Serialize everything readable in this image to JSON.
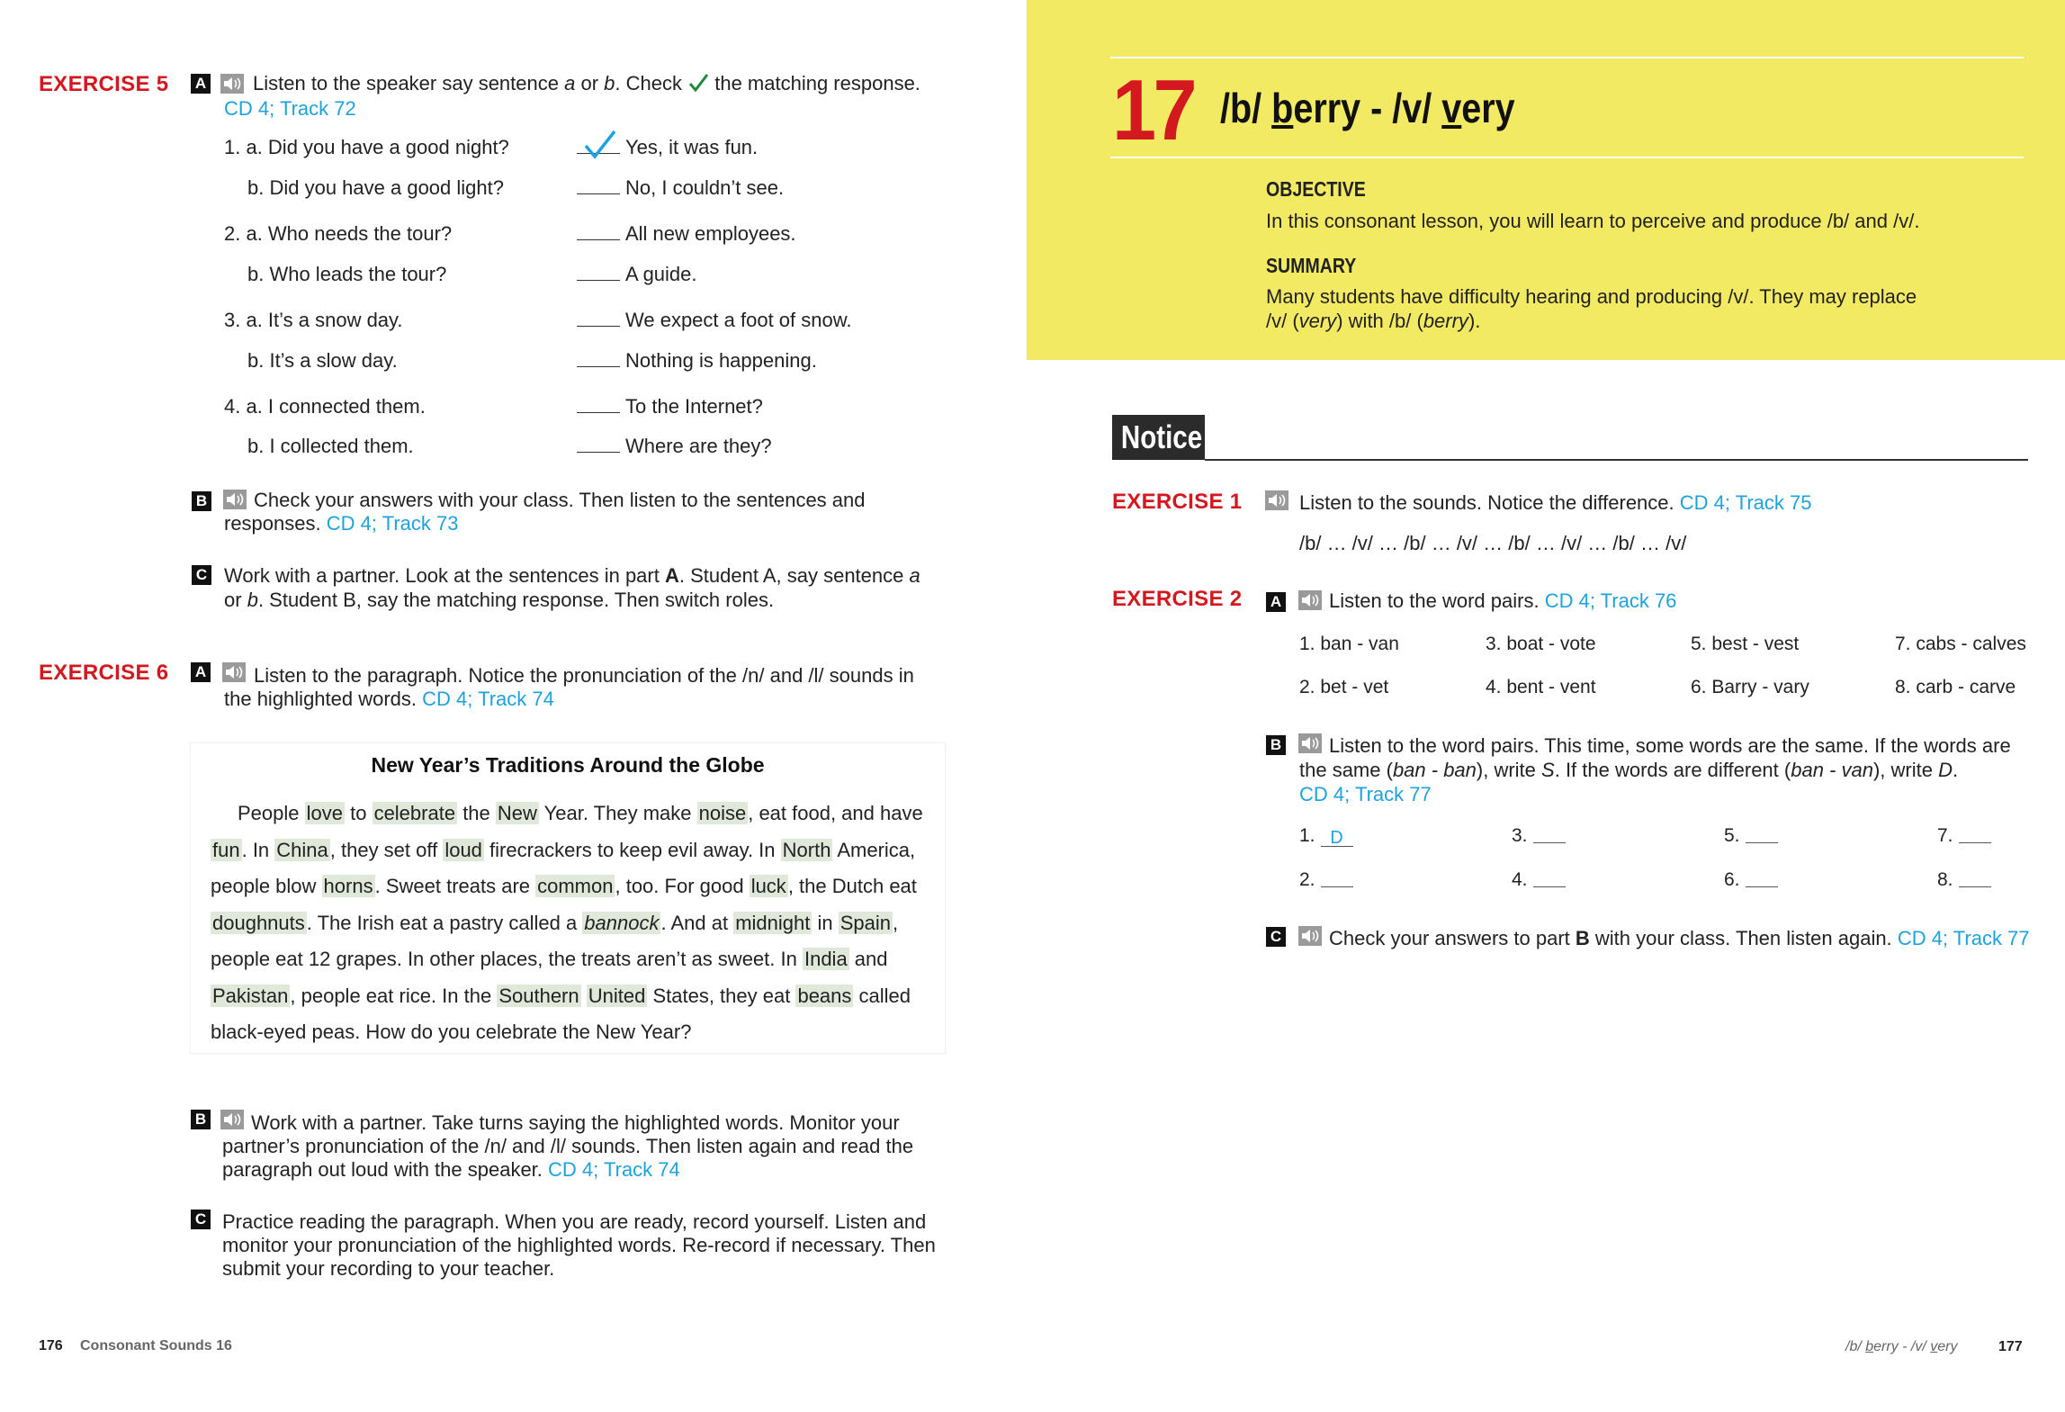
{
  "left": {
    "ex5": {
      "label": "EXERCISE 5",
      "a_letter": "A",
      "a_text1": "Listen to the speaker say sentence ",
      "a_text_a": "a",
      "a_text_or": " or ",
      "a_text_b": "b",
      "a_text2": ". Check ",
      "a_text3": " the matching response.",
      "a_track": "CD 4; Track 72",
      "items": [
        {
          "q": "1. a. Did you have a good night?",
          "r": "Yes, it was fun.",
          "checked": true
        },
        {
          "q": "b. Did you have a good light?",
          "r": "No, I couldn’t see.",
          "checked": false
        },
        {
          "q": "2. a. Who needs the tour?",
          "r": "All new employees.",
          "checked": false
        },
        {
          "q": "b. Who leads the tour?",
          "r": "A guide.",
          "checked": false
        },
        {
          "q": "3. a. It’s a snow day.",
          "r": "We expect a foot of snow.",
          "checked": false
        },
        {
          "q": "b. It’s a slow day.",
          "r": "Nothing is happening.",
          "checked": false
        },
        {
          "q": "4. a. I connected them.",
          "r": "To the Internet?",
          "checked": false
        },
        {
          "q": "b. I collected them.",
          "r": "Where are they?",
          "checked": false
        }
      ],
      "b_letter": "B",
      "b_text1": "Check your answers with your class. Then listen to the sentences and",
      "b_text2": "responses.",
      "b_track": "CD 4; Track 73",
      "c_letter": "C",
      "c_text1a": "Work with a partner. Look at the sentences in part ",
      "c_text1b": "A",
      "c_text1c": ". Student A, say sentence ",
      "c_text1d": "a",
      "c_text2a": "or ",
      "c_text2b": "b",
      "c_text2c": ". Student B, say the matching response. Then switch roles."
    },
    "ex6": {
      "label": "EXERCISE 6",
      "a_letter": "A",
      "a_text1": "Listen to the paragraph. Notice the pronunciation of the /n/ and /l/ sounds in",
      "a_text2": "the highlighted words.",
      "a_track": "CD 4; Track 74",
      "box_title": "New Year’s Traditions Around the Globe",
      "b_letter": "B",
      "b_text1": "Work with a partner. Take turns saying the highlighted words. Monitor your",
      "b_text2": "partner’s pronunciation of the /n/ and /l/ sounds. Then listen again and read the",
      "b_text3": "paragraph out loud with the speaker.",
      "b_track": "CD 4; Track 74",
      "c_letter": "C",
      "c_text1": "Practice reading the paragraph. When you are ready, record yourself. Listen and",
      "c_text2": "monitor your pronunciation of the highlighted words. Re-record if necessary. Then",
      "c_text3": "submit your recording to your teacher."
    },
    "footer_num": "176",
    "footer_text": "Consonant Sounds 16"
  },
  "paragraph": [
    [
      {
        "t": "People "
      },
      {
        "t": "love",
        "h": 1
      },
      {
        "t": " to "
      },
      {
        "t": "celebrate",
        "h": 1
      },
      {
        "t": " the "
      },
      {
        "t": "New",
        "h": 1
      },
      {
        "t": " Year. They make "
      },
      {
        "t": "noise",
        "h": 1
      },
      {
        "t": ", eat food, and have"
      }
    ],
    [
      {
        "t": "fun",
        "h": 1
      },
      {
        "t": ". In "
      },
      {
        "t": "China",
        "h": 1
      },
      {
        "t": ", they set off "
      },
      {
        "t": "loud",
        "h": 1
      },
      {
        "t": " firecrackers to keep evil away. In "
      },
      {
        "t": "North",
        "h": 1
      },
      {
        "t": " America,"
      }
    ],
    [
      {
        "t": "people blow "
      },
      {
        "t": "horns",
        "h": 1
      },
      {
        "t": ". Sweet treats are "
      },
      {
        "t": "common",
        "h": 1
      },
      {
        "t": ", too. For good "
      },
      {
        "t": "luck",
        "h": 1
      },
      {
        "t": ", the Dutch eat"
      }
    ],
    [
      {
        "t": "doughnuts",
        "h": 1
      },
      {
        "t": ". The Irish eat a pastry called a "
      },
      {
        "t": "bannock",
        "h": 1,
        "i": 1
      },
      {
        "t": ". And at "
      },
      {
        "t": "midnight",
        "h": 1
      },
      {
        "t": " in "
      },
      {
        "t": "Spain",
        "h": 1
      },
      {
        "t": ","
      }
    ],
    [
      {
        "t": "people eat 12 grapes. In other places, the treats aren’t as sweet. In "
      },
      {
        "t": "India",
        "h": 1
      },
      {
        "t": " and"
      }
    ],
    [
      {
        "t": "Pakistan",
        "h": 1
      },
      {
        "t": ", people eat rice. In the "
      },
      {
        "t": "Southern",
        "h": 1
      },
      {
        "t": " "
      },
      {
        "t": "United",
        "h": 1
      },
      {
        "t": " States, they eat "
      },
      {
        "t": "beans",
        "h": 1
      },
      {
        "t": " called"
      }
    ],
    [
      {
        "t": "black-eyed peas. How do you celebrate the New Year?"
      }
    ]
  ],
  "right": {
    "unit_num": "17",
    "unit_b": "/b/ ",
    "unit_berry_b": "b",
    "unit_berry_rest": "erry",
    "unit_dash": " - /v/ ",
    "unit_very_v": "v",
    "unit_very_rest": "ery",
    "objective_label": "OBJECTIVE",
    "objective_text": "In this consonant lesson, you will learn to perceive and produce /b/ and /v/.",
    "summary_label": "SUMMARY",
    "summary_text1": "Many students have difficulty hearing and producing /v/. They may replace",
    "summary_text2a": "/v/ (",
    "summary_text2b": "very",
    "summary_text2c": ") with /b/ (",
    "summary_text2d": "berry",
    "summary_text2e": ").",
    "notice": "Notice",
    "ex1": {
      "label": "EXERCISE 1",
      "text": "Listen to the sounds. Notice the difference.",
      "track": "CD 4; Track 75",
      "sounds": "/b/ … /v/ … /b/ … /v/ … /b/ … /v/ … /b/ … /v/"
    },
    "ex2": {
      "label": "EXERCISE 2",
      "a_letter": "A",
      "a_text": "Listen to the word pairs.",
      "a_track": "CD 4; Track 76",
      "pairs": [
        "1. ban - van",
        "3. boat - vote",
        "5. best - vest",
        "7. cabs - calves",
        "2. bet - vet",
        "4. bent - vent",
        "6. Barry - vary",
        "8. carb - carve"
      ],
      "b_letter": "B",
      "b_text1": "Listen to the word pairs. This time, some words are the same. If the words are",
      "b_text2a": "the same (",
      "b_text2b": "ban - ban",
      "b_text2c": "), write ",
      "b_text2d": "S",
      "b_text2e": ". If the words are different (",
      "b_text2f": "ban - van",
      "b_text2g": "), write ",
      "b_text2h": "D",
      "b_text2i": ".",
      "b_track": "CD 4; Track 77",
      "answers": [
        {
          "n": "1.",
          "v": "D"
        },
        {
          "n": "3.",
          "v": ""
        },
        {
          "n": "5.",
          "v": ""
        },
        {
          "n": "7.",
          "v": ""
        },
        {
          "n": "2.",
          "v": ""
        },
        {
          "n": "4.",
          "v": ""
        },
        {
          "n": "6.",
          "v": ""
        },
        {
          "n": "8.",
          "v": ""
        }
      ],
      "c_letter": "C",
      "c_text1": "Check your answers to part ",
      "c_text2": "B",
      "c_text3": " with your class. Then listen again.",
      "c_track": "CD 4; Track 77"
    },
    "footer_b": "/b/ ",
    "footer_b_u": "b",
    "footer_berry": "erry",
    "footer_dash": " - /v/ ",
    "footer_v_u": "v",
    "footer_very": "ery",
    "footer_num": "177"
  },
  "colors": {
    "red": "#d4181f",
    "blue": "#1ea2dd",
    "yellow": "#f3ea64",
    "highlight": "#e0e8da"
  }
}
